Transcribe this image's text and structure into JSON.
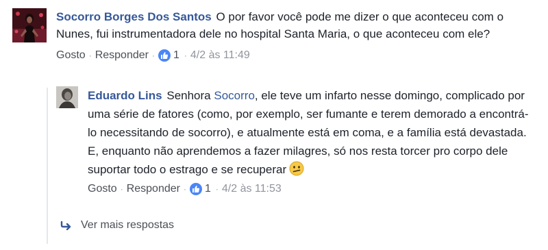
{
  "comment1": {
    "author": "Socorro Borges Dos Santos",
    "text": "O por favor você pode me dizer o que aconteceu com o Nunes, fui instrumentadora dele no hospital Santa Maria, o que aconteceu com ele?",
    "like_label": "Gosto",
    "reply_label": "Responder",
    "separator": "·",
    "likes": "1",
    "timestamp": "4/2 às 11:49"
  },
  "comment2": {
    "author": "Eduardo Lins",
    "text_before": "Senhora",
    "mention": "Socorro",
    "text_after": ", ele teve um infarto nesse domingo, complicado por uma série de fatores (como, por exemplo, ser fumante e terem demorado a encontrá-lo necessitando de socorro), e atualmente está em coma, e a família está devastada.",
    "text_line2": "E, enquanto não aprendemos a fazer milagres, só nos resta torcer pro corpo dele suportar todo o estrago e se recuperar",
    "emoji": "confused-face",
    "like_label": "Gosto",
    "reply_label": "Responder",
    "separator": "·",
    "likes": "1",
    "timestamp": "4/2 às 11:53"
  },
  "more_replies": {
    "label": "Ver mais respostas"
  },
  "colors": {
    "link": "#365899",
    "text": "#1d2129",
    "meta": "#90949c",
    "like": "#4a86f7"
  }
}
